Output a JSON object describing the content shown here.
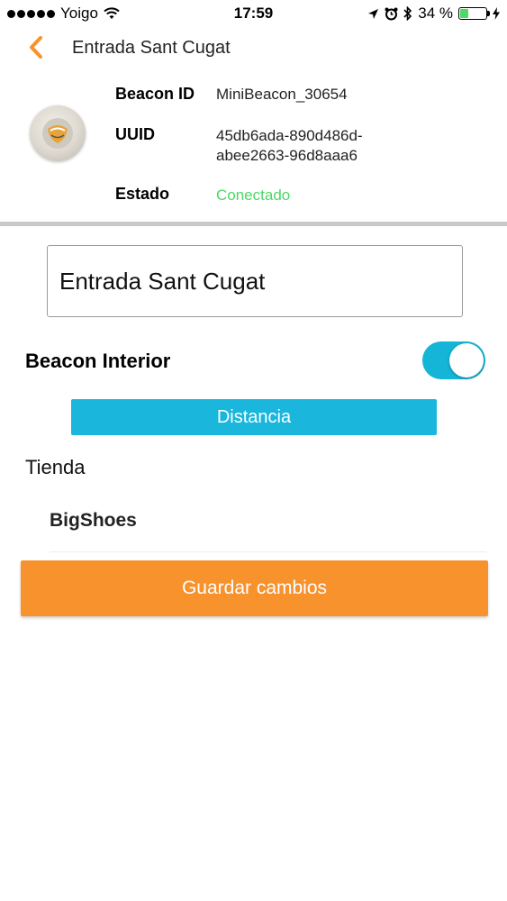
{
  "status_bar": {
    "carrier": "Yoigo",
    "time": "17:59",
    "battery": "34 %",
    "battery_level": 0.34,
    "icons": [
      "signal-icon",
      "wifi-icon",
      "location-icon",
      "alarm-icon",
      "bluetooth-icon",
      "battery-icon",
      "charging-icon"
    ]
  },
  "nav": {
    "back_icon": "chevron-left-icon",
    "title": "Entrada Sant Cugat"
  },
  "beacon": {
    "id_label": "Beacon ID",
    "id_value": "MiniBeacon_30654",
    "uuid_label": "UUID",
    "uuid_value_line1": "45db6ada-890d486d-",
    "uuid_value_line2": "abee2663-96d8aaa6",
    "status_label": "Estado",
    "status_value": "Conectado",
    "status_color": "#4cd964"
  },
  "form": {
    "name_value": "Entrada Sant Cugat",
    "interior_label": "Beacon Interior",
    "interior_on": true,
    "distance_button": "Distancia",
    "store_section": "Tienda",
    "store_item": "BigShoes",
    "save_button": "Guardar cambios"
  },
  "colors": {
    "accent_orange": "#f7922d",
    "accent_blue": "#1ab6dc",
    "toggle_on": "#14b5d6"
  }
}
